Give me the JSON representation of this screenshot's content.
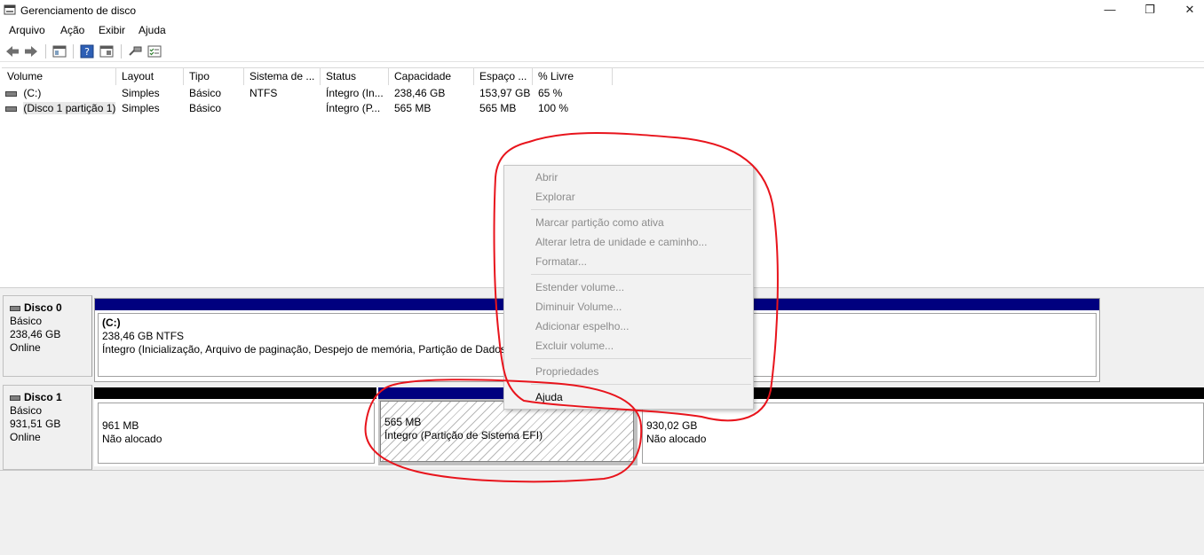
{
  "window": {
    "title": "Gerenciamento de disco",
    "controls": {
      "minimize": "—",
      "maximize": "❐",
      "close": "✕"
    }
  },
  "menu": [
    "Arquivo",
    "Ação",
    "Exibir",
    "Ajuda"
  ],
  "toolbar": {
    "icons": [
      "back-arrow-icon",
      "forward-arrow-icon",
      "console-tree-icon",
      "help-icon",
      "properties-icon",
      "connect-drive-icon",
      "checklist-icon"
    ]
  },
  "volume_table": {
    "columns": [
      "Volume",
      "Layout",
      "Tipo",
      "Sistema de ...",
      "Status",
      "Capacidade",
      "Espaço ...",
      "% Livre"
    ],
    "rows": [
      [
        "(C:)",
        "Simples",
        "Básico",
        "NTFS",
        "Íntegro (In...",
        "238,46 GB",
        "153,97 GB",
        "65 %"
      ],
      [
        "(Disco 1 partição 1)",
        "Simples",
        "Básico",
        "",
        "Íntegro (P...",
        "565 MB",
        "565 MB",
        "100 %"
      ]
    ]
  },
  "disks": [
    {
      "name": "Disco 0",
      "type": "Básico",
      "size": "238,46 GB",
      "state": "Online",
      "partitions": [
        {
          "label": "(C:)",
          "size": "238,46 GB NTFS",
          "status": "Íntegro (Inicialização, Arquivo de paginação, Despejo de memória, Partição de Dados B"
        }
      ]
    },
    {
      "name": "Disco 1",
      "type": "Básico",
      "size": "931,51 GB",
      "state": "Online",
      "partitions": [
        {
          "size": "961 MB",
          "status": "Não alocado"
        },
        {
          "size": "565 MB",
          "status": "Íntegro (Partição de Sistema EFI)"
        },
        {
          "size": "930,02 GB",
          "status": "Não alocado"
        }
      ]
    }
  ],
  "context_menu": {
    "items": [
      {
        "label": "Abrir",
        "enabled": false
      },
      {
        "label": "Explorar",
        "enabled": false
      },
      {
        "label": "Marcar partição como ativa",
        "enabled": false
      },
      {
        "label": "Alterar letra de unidade e caminho...",
        "enabled": false
      },
      {
        "label": "Formatar...",
        "enabled": false
      },
      {
        "label": "Estender volume...",
        "enabled": false
      },
      {
        "label": "Diminuir Volume...",
        "enabled": false
      },
      {
        "label": "Adicionar espelho...",
        "enabled": false
      },
      {
        "label": "Excluir volume...",
        "enabled": false
      },
      {
        "label": "Propriedades",
        "enabled": false
      },
      {
        "label": "Ajuda",
        "enabled": true
      }
    ]
  },
  "colors": {
    "primary_partition_bar": "#00007f",
    "unallocated_bar": "#000000",
    "annotation": "#e8141c",
    "disabled_text": "#8c8c8c"
  }
}
